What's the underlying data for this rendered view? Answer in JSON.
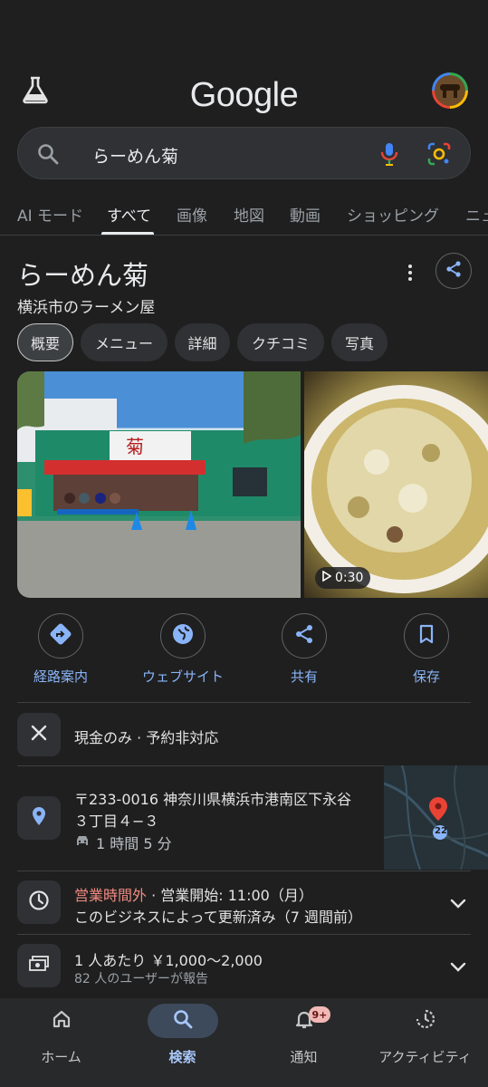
{
  "header": {
    "logo": "Google",
    "lab_icon": "flask-icon",
    "avatar_icon": "profile-avatar"
  },
  "search": {
    "query": "らーめん菊"
  },
  "tabs": [
    {
      "label": "AI モード"
    },
    {
      "label": "すべて"
    },
    {
      "label": "画像"
    },
    {
      "label": "地図"
    },
    {
      "label": "動画"
    },
    {
      "label": "ショッピング"
    },
    {
      "label": "ニュ"
    }
  ],
  "place": {
    "name": "らーめん菊",
    "category": "横浜市のラーメン屋"
  },
  "chips": [
    {
      "label": "概要"
    },
    {
      "label": "メニュー"
    },
    {
      "label": "詳細"
    },
    {
      "label": "クチコミ"
    },
    {
      "label": "写真"
    }
  ],
  "photos": {
    "video_duration": "0:30"
  },
  "actions": [
    {
      "label": "経路案内",
      "icon": "directions-icon"
    },
    {
      "label": "ウェブサイト",
      "icon": "globe-icon"
    },
    {
      "label": "共有",
      "icon": "share-icon"
    },
    {
      "label": "保存",
      "icon": "bookmark-icon"
    }
  ],
  "info": {
    "payment": "現金のみ · 予約非対応",
    "address_line1": "〒233-0016 神奈川県横浜市港南区下永谷",
    "address_line2": "３丁目４−３",
    "drive_time": "1 時間 5 分",
    "map_route_label": "22",
    "hours_status": "営業時間外",
    "hours_detail": " · 営業開始: 11:00（月）",
    "hours_updated": "このビジネスによって更新済み（7 週間前）",
    "price": "1 人あたり ￥1,000〜2,000",
    "price_note": "82 人のユーザーが報告"
  },
  "nav": [
    {
      "label": "ホーム",
      "icon": "home-icon"
    },
    {
      "label": "検索",
      "icon": "search-icon"
    },
    {
      "label": "通知",
      "icon": "bell-icon",
      "badge": "9+"
    },
    {
      "label": "アクティビティ",
      "icon": "activity-icon"
    }
  ],
  "colors": {
    "accent": "#8ab4f8",
    "closed": "#f28b82",
    "background": "#1f1f1f"
  }
}
